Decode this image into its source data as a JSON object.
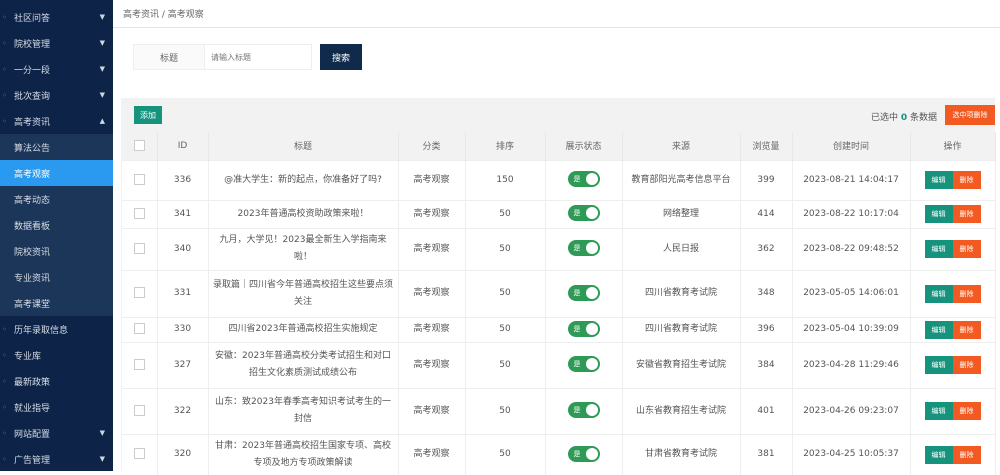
{
  "sidebar": {
    "items": [
      {
        "label": "社区问答",
        "arrow": "▼",
        "sub": false
      },
      {
        "label": "院校管理",
        "arrow": "▼",
        "sub": false
      },
      {
        "label": "一分一段",
        "arrow": "▼",
        "sub": false
      },
      {
        "label": "批次查询",
        "arrow": "▼",
        "sub": false
      },
      {
        "label": "高考资讯",
        "arrow": "▲",
        "sub": false
      },
      {
        "label": "算法公告",
        "arrow": "",
        "sub": true
      },
      {
        "label": "高考观察",
        "arrow": "",
        "sub": true,
        "active": true
      },
      {
        "label": "高考动态",
        "arrow": "",
        "sub": true
      },
      {
        "label": "数据看板",
        "arrow": "",
        "sub": true
      },
      {
        "label": "院校资讯",
        "arrow": "",
        "sub": true
      },
      {
        "label": "专业资讯",
        "arrow": "",
        "sub": true
      },
      {
        "label": "高考课堂",
        "arrow": "",
        "sub": true
      },
      {
        "label": "历年录取信息",
        "arrow": "",
        "sub": false
      },
      {
        "label": "专业库",
        "arrow": "",
        "sub": false
      },
      {
        "label": "最新政策",
        "arrow": "",
        "sub": false
      },
      {
        "label": "就业指导",
        "arrow": "",
        "sub": false
      },
      {
        "label": "网站配置",
        "arrow": "▼",
        "sub": false
      },
      {
        "label": "广告管理",
        "arrow": "▼",
        "sub": false
      }
    ]
  },
  "breadcrumb": "高考资讯  /  高考观察",
  "search": {
    "label": "标题",
    "placeholder": "请输入标题",
    "button": "搜索"
  },
  "toolbar": {
    "add": "添加",
    "selected_prefix": "已选中",
    "selected_count": "0",
    "selected_suffix": "条数据",
    "batch_delete": "选中项删除"
  },
  "table": {
    "headers": [
      "ID",
      "标题",
      "分类",
      "排序",
      "展示状态",
      "来源",
      "浏览量",
      "创建时间",
      "操作"
    ],
    "toggle_label": "是",
    "edit": "编辑",
    "delete": "删除",
    "rows": [
      {
        "id": "336",
        "title": "@准大学生：新的起点，你准备好了吗?",
        "cat": "高考观察",
        "sort": "150",
        "source": "教育部阳光高考信息平台",
        "views": "399",
        "time": "2023-08-21 14:04:17"
      },
      {
        "id": "341",
        "title": "2023年普通高校资助政策来啦！",
        "cat": "高考观察",
        "sort": "50",
        "source": "网络整理",
        "views": "414",
        "time": "2023-08-22 10:17:04"
      },
      {
        "id": "340",
        "title": "九月，大学见！2023最全新生入学指南来啦！",
        "cat": "高考观察",
        "sort": "50",
        "source": "人民日报",
        "views": "362",
        "time": "2023-08-22 09:48:52"
      },
      {
        "id": "331",
        "title": "录取篇｜四川省今年普通高校招生这些要点须关注",
        "cat": "高考观察",
        "sort": "50",
        "source": "四川省教育考试院",
        "views": "348",
        "time": "2023-05-05 14:06:01"
      },
      {
        "id": "330",
        "title": "四川省2023年普通高校招生实施规定",
        "cat": "高考观察",
        "sort": "50",
        "source": "四川省教育考试院",
        "views": "396",
        "time": "2023-05-04 10:39:09"
      },
      {
        "id": "327",
        "title": "安徽：2023年普通高校分类考试招生和对口招生文化素质测试成绩公布",
        "cat": "高考观察",
        "sort": "50",
        "source": "安徽省教育招生考试院",
        "views": "384",
        "time": "2023-04-28 11:29:46"
      },
      {
        "id": "322",
        "title": "山东：致2023年春季高考知识考试考生的一封信",
        "cat": "高考观察",
        "sort": "50",
        "source": "山东省教育招生考试院",
        "views": "401",
        "time": "2023-04-26 09:23:07"
      },
      {
        "id": "320",
        "title": "甘肃：2023年普通高校招生国家专项、高校专项及地方专项政策解读",
        "cat": "高考观察",
        "sort": "50",
        "source": "甘肃省教育考试院",
        "views": "381",
        "time": "2023-04-25 10:05:37"
      }
    ]
  }
}
